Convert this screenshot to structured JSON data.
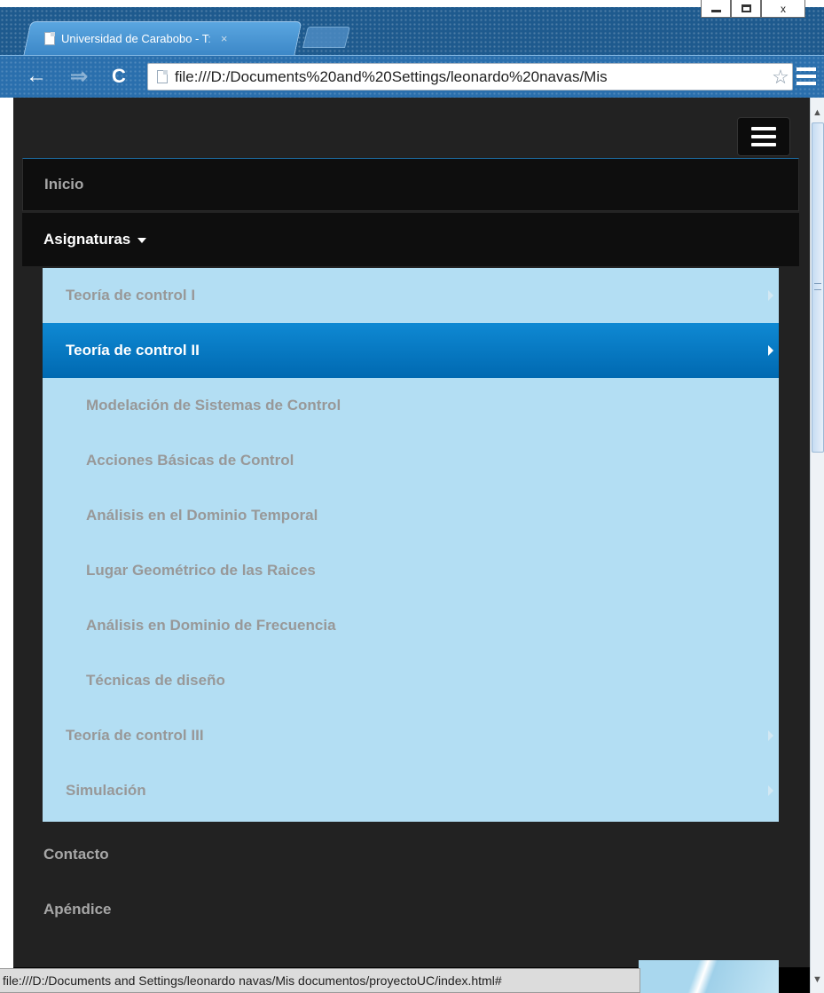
{
  "browser": {
    "tab_title": "Universidad de Carabobo - T",
    "tab_title_fade": ":",
    "tab_close": "×",
    "url": "file:///D:/Documents%20and%20Settings/leonardo%20navas/Mis",
    "status_url": "file:///D:/Documents and Settings/leonardo navas/Mis documentos/proyectoUC/index.html#",
    "icons": {
      "back": "←",
      "forward": "⇒",
      "reload": "C",
      "star": "☆",
      "minimize": "minimize-icon",
      "maximize": "maximize-icon",
      "close": "x"
    }
  },
  "nav": {
    "items": [
      {
        "label": "Inicio"
      },
      {
        "label": "Asignaturas"
      },
      {
        "label": "Contacto"
      },
      {
        "label": "Apéndice"
      }
    ],
    "dropdown": [
      {
        "label": "Teoría de control I",
        "has_submenu": true,
        "active": false
      },
      {
        "label": "Teoría de control II",
        "has_submenu": true,
        "active": true
      },
      {
        "label": "Modelación de Sistemas de Control",
        "has_submenu": false,
        "active": false
      },
      {
        "label": "Acciones Básicas de Control",
        "has_submenu": false,
        "active": false
      },
      {
        "label": "Análisis en el Dominio Temporal",
        "has_submenu": false,
        "active": false
      },
      {
        "label": "Lugar Geométrico de las Raices",
        "has_submenu": false,
        "active": false
      },
      {
        "label": "Análisis en Dominio de Frecuencia",
        "has_submenu": false,
        "active": false
      },
      {
        "label": "Técnicas de diseño",
        "has_submenu": false,
        "active": false
      },
      {
        "label": "Teoría de control III",
        "has_submenu": true,
        "active": false
      },
      {
        "label": "Simulación",
        "has_submenu": true,
        "active": false
      }
    ]
  },
  "colors": {
    "navbar_bg": "#222222",
    "dropdown_bg": "#b3def3",
    "active_item": "#0a7cc4",
    "browser_chrome": "#2a6fad"
  }
}
